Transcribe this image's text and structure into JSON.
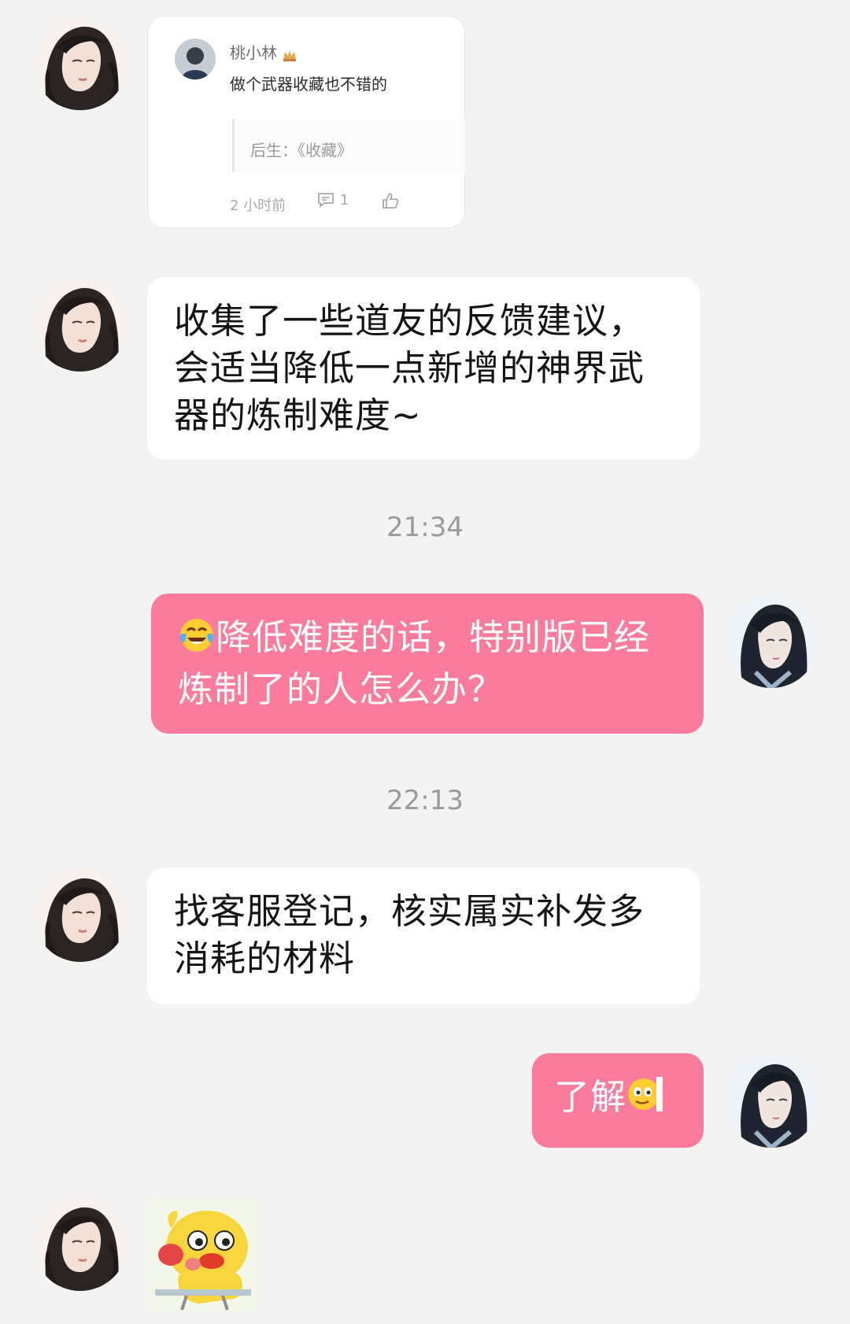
{
  "shared_post": {
    "author": "桃小林",
    "text": "做个武器收藏也不错的",
    "quote": "后生：《收藏》",
    "time_ago": "2 小时前",
    "comment_count": "1",
    "author_badge_icon": "crown-badge-icon",
    "comment_icon": "comment-icon",
    "like_icon": "thumbs-up-icon"
  },
  "messages": [
    {
      "side": "left",
      "text": "收集了一些道友的反馈建议，会适当降低一点新增的神界武器的炼制难度~"
    },
    {
      "side": "right",
      "emoji": "crying-laughing-emoji",
      "text": "降低难度的话，特别版已经炼制了的人怎么办？"
    },
    {
      "side": "left",
      "text": "找客服登记，核实属实补发多消耗的材料"
    },
    {
      "side": "right",
      "text": "了解",
      "emoji": "peeking-face-emoji"
    },
    {
      "side": "left",
      "sticker": "yellow-chick-sticker"
    }
  ],
  "timestamps": [
    "21:34",
    "22:13"
  ],
  "colors": {
    "background": "#f3f3f3",
    "incoming_bubble": "#ffffff",
    "outgoing_bubble": "#fb7b9c",
    "timestamp": "#9a9a9a"
  }
}
